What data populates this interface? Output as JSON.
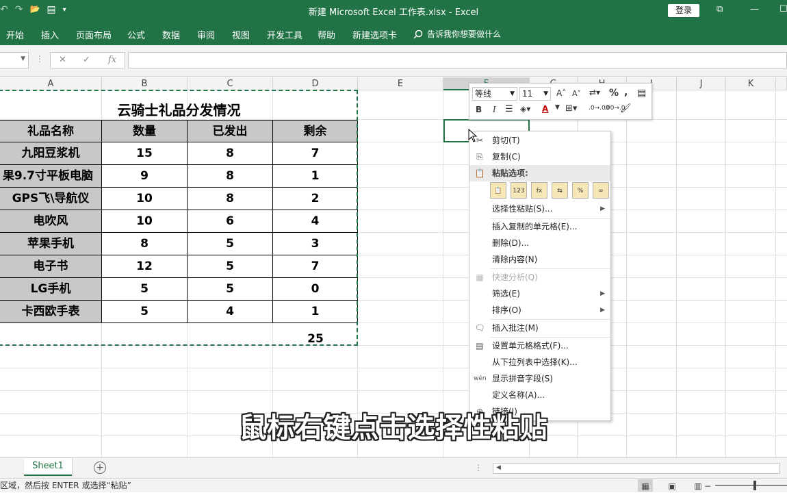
{
  "window": {
    "title": "新建 Microsoft Excel 工作表.xlsx  -  Excel",
    "login_label": "登录",
    "qat": {
      "undo_icon": "↶",
      "redo_icon": "↷",
      "open_icon": "📂",
      "form_icon": "▤",
      "more_icon": "▾"
    },
    "buttons": {
      "restore_ribbon": "⧉",
      "minimize": "—",
      "maximize": "☐"
    }
  },
  "ribbon": {
    "tabs": [
      "开始",
      "插入",
      "页面布局",
      "公式",
      "数据",
      "审阅",
      "视图",
      "开发工具",
      "帮助",
      "新建选项卡"
    ],
    "tell_me": "告诉我你想要做什么"
  },
  "formula_bar": {
    "name_box": "",
    "cancel": "✕",
    "enter": "✓",
    "fx": "fx",
    "value": ""
  },
  "columns": [
    "A",
    "B",
    "C",
    "D",
    "E",
    "F",
    "G",
    "H",
    "I",
    "J",
    "K"
  ],
  "table": {
    "title": "云骑士礼品分发情况",
    "headers": [
      "礼品名称",
      "数量",
      "已发出",
      "剩余"
    ],
    "rows": [
      [
        "九阳豆浆机",
        "15",
        "8",
        "7"
      ],
      [
        "果9.7寸平板电脑",
        "9",
        "8",
        "1"
      ],
      [
        "GPS飞\\导航仪",
        "10",
        "8",
        "2"
      ],
      [
        "电吹风",
        "10",
        "6",
        "4"
      ],
      [
        "苹果手机",
        "8",
        "5",
        "3"
      ],
      [
        "电子书",
        "12",
        "5",
        "7"
      ],
      [
        "LG手机",
        "5",
        "5",
        "0"
      ],
      [
        "卡西欧手表",
        "5",
        "4",
        "1"
      ]
    ],
    "total": "25"
  },
  "mini_toolbar": {
    "font": "等线",
    "size": "11",
    "grow": "A˄",
    "shrink": "A˅",
    "percent": "%",
    "comma": ",",
    "bold": "B",
    "italic": "I",
    "decrease_decimal": ".00→.0",
    "increase_decimal": ".0→.00"
  },
  "context_menu": {
    "cut": "剪切(T)",
    "copy": "复制(C)",
    "paste_options": "粘贴选项:",
    "paste_special": "选择性粘贴(S)...",
    "insert_copied": "插入复制的单元格(E)...",
    "delete": "删除(D)...",
    "clear": "清除内容(N)",
    "quick_analysis": "快速分析(Q)",
    "filter": "筛选(E)",
    "sort": "排序(O)",
    "insert_comment": "插入批注(M)",
    "format_cells": "设置单元格格式(F)...",
    "pick_list": "从下拉列表中选择(K)...",
    "phonetic": "显示拼音字段(S)",
    "define_name": "定义名称(A)...",
    "link": "链接(I)"
  },
  "subtitle": "鼠标右键点击选择性粘贴",
  "sheets": {
    "active": "Sheet1",
    "add": "+"
  },
  "status": {
    "message": "区域，然后按 ENTER 或选择“粘贴”"
  },
  "colors": {
    "excel_green": "#217346",
    "header_gray": "#c8c8c8"
  }
}
